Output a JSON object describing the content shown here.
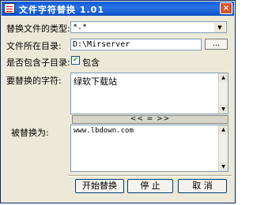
{
  "window": {
    "title": "文件字符替换 1.01",
    "close_label": "×",
    "icon": "app-icon"
  },
  "form": {
    "filetype_label": "替换文件的类型:",
    "filetype_value": "*.*",
    "dir_label": "文件所在目录:",
    "dir_value": "D:\\Mirserver",
    "browse_label": "...",
    "subdir_label": "是否包含子目录:",
    "subdir_checkbox_label": "包含",
    "subdir_checked": true,
    "find_label": "要替换的字符:",
    "find_value": "绿软下载站",
    "swap_label": "<< = >>",
    "replace_label": "被替换为:",
    "replace_value": "www.lbdown.com"
  },
  "buttons": {
    "start": "开始替换",
    "stop": "停 止",
    "cancel": "取 消"
  }
}
